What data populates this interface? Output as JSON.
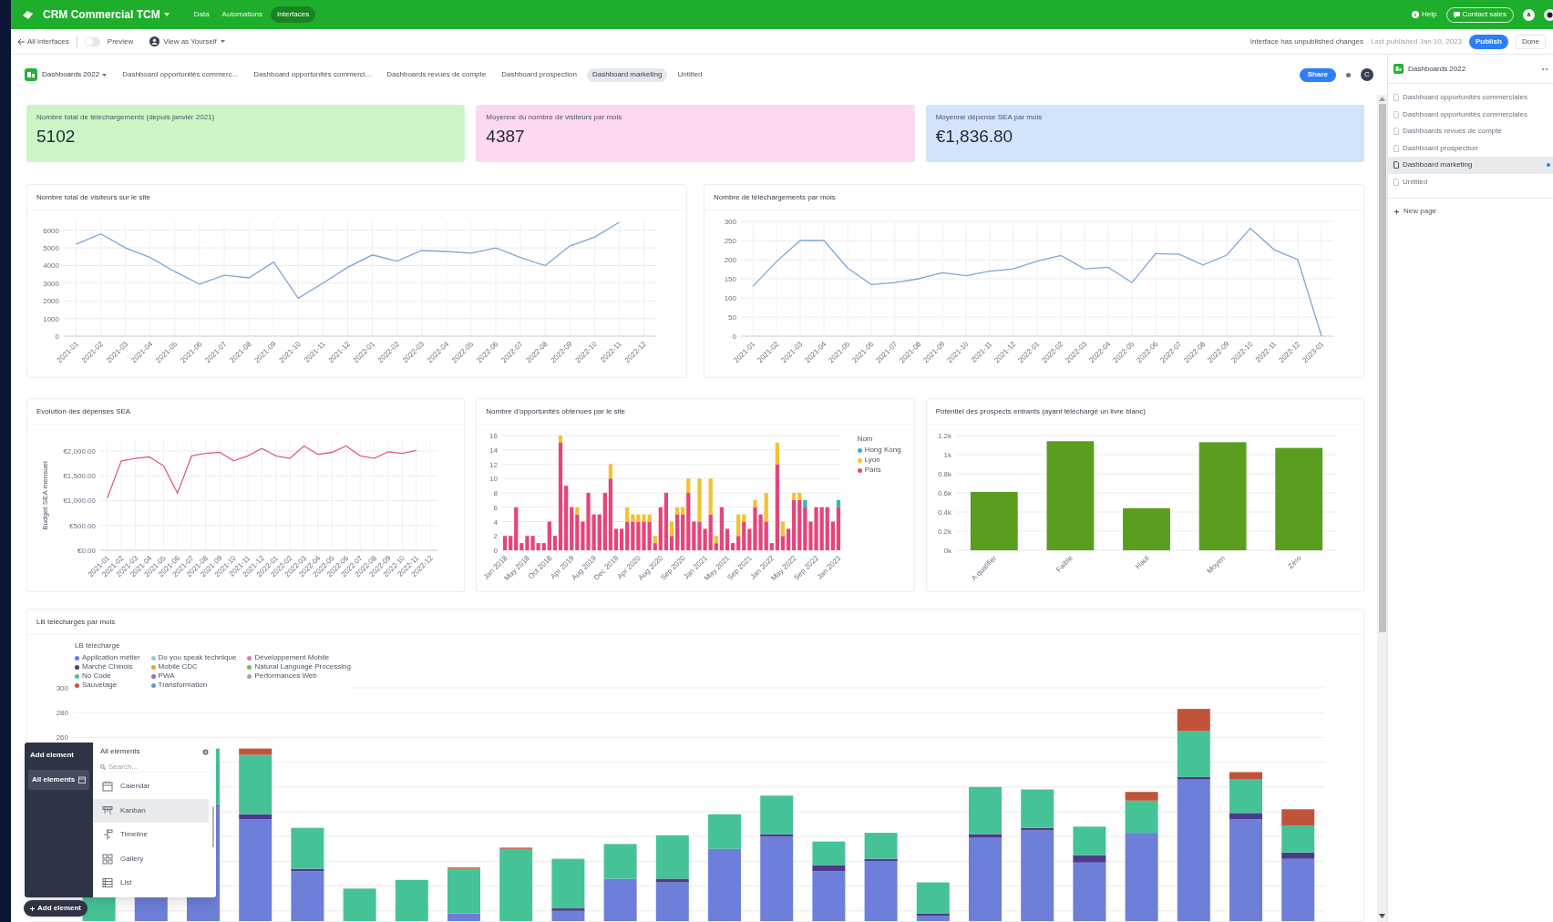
{
  "header": {
    "base_name": "CRM Commercial TCM",
    "nav": [
      {
        "label": "Data",
        "selected": false
      },
      {
        "label": "Automations",
        "selected": false
      },
      {
        "label": "Interfaces",
        "selected": true
      }
    ],
    "help": "Help",
    "contact": "Contact sales"
  },
  "toolbar": {
    "back": "All interfaces",
    "preview": {
      "label": "Preview",
      "on": false
    },
    "view_as": "View as Yourself",
    "status": "Interface has unpublished changes",
    "last_published": "Last published Jan 10, 2023",
    "publish": "Publish",
    "done": "Done"
  },
  "page_tabs": {
    "group": "Dashboards 2022",
    "tabs": [
      {
        "label": "Dashboard opportunités commerc...",
        "selected": false
      },
      {
        "label": "Dashboard opportunités commerci...",
        "selected": false
      },
      {
        "label": "Dashboards revues de compte",
        "selected": false
      },
      {
        "label": "Dashboard prospection",
        "selected": false
      },
      {
        "label": "Dashboard marketing",
        "selected": true
      },
      {
        "label": "Untitled",
        "selected": false
      }
    ],
    "share": "Share",
    "avatar": "C"
  },
  "kpis": [
    {
      "label": "Nombre total de téléchargements (depuis janvier 2021)",
      "value": "5102",
      "color": "#cdf6c6"
    },
    {
      "label": "Moyenne du nombre de visiteurs par mois",
      "value": "4387",
      "color": "#fcd9f1"
    },
    {
      "label": "Moyenne dépense SEA par mois",
      "value": "€1,836.80",
      "color": "#d3e3fb"
    }
  ],
  "charts": [
    {
      "title": "Nombre total de visiteurs sur le site",
      "chart_data": {
        "type": "line",
        "categories": [
          "2021-01",
          "2021-02",
          "2021-03",
          "2021-04",
          "2021-05",
          "2021-06",
          "2021-07",
          "2021-08",
          "2021-09",
          "2021-10",
          "2021-11",
          "2021-12",
          "2022-01",
          "2022-02",
          "2022-03",
          "2022-04",
          "2022-05",
          "2022-06",
          "2022-07",
          "2022-08",
          "2022-09",
          "2022-10",
          "2022-11",
          "2022-12"
        ],
        "series": [
          {
            "color": "#7ea6d6",
            "values": [
              5200,
              5800,
              5000,
              4450,
              3650,
              2950,
              3450,
              3300,
              4200,
              2150,
              3000,
              3900,
              4600,
              4250,
              4850,
              4800,
              4700,
              5000,
              4450,
              4000,
              5100,
              5600,
              6450,
              null
            ]
          }
        ],
        "ylim": [
          0,
          6500
        ],
        "yticks": [
          0,
          1000,
          2000,
          3000,
          4000,
          5000,
          6000
        ],
        "grid": true
      }
    },
    {
      "title": "Nombre de téléchargements par mois",
      "chart_data": {
        "type": "line",
        "categories": [
          "2021-01",
          "2021-02",
          "2021-03",
          "2021-04",
          "2021-05",
          "2021-06",
          "2021-07",
          "2021-08",
          "2021-09",
          "2021-10",
          "2021-11",
          "2021-12",
          "2022-01",
          "2022-02",
          "2022-03",
          "2022-04",
          "2022-05",
          "2022-06",
          "2022-07",
          "2022-08",
          "2022-09",
          "2022-10",
          "2022-11",
          "2022-12",
          "2023-01"
        ],
        "series": [
          {
            "color": "#7ea6d6",
            "values": [
              130,
              195,
              250,
              250,
              178,
              135,
              140,
              150,
              166,
              158,
              170,
              176,
              196,
              211,
              176,
              180,
              140,
              216,
              214,
              186,
              212,
              282,
              226,
              200,
              0
            ]
          }
        ],
        "ylim": [
          0,
          300
        ],
        "yticks": [
          0,
          50,
          100,
          150,
          200,
          250,
          300
        ],
        "grid": true
      }
    },
    {
      "title": "Evolution des dépenses SEA",
      "chart_data": {
        "type": "line",
        "ylabel": "Budget SEA mensuel",
        "categories": [
          "2021-01",
          "2021-02",
          "2021-03",
          "2021-04",
          "2021-05",
          "2021-06",
          "2021-07",
          "2021-08",
          "2021-09",
          "2021-10",
          "2021-11",
          "2021-12",
          "2022-01",
          "2022-02",
          "2022-03",
          "2022-04",
          "2022-05",
          "2022-06",
          "2022-07",
          "2022-08",
          "2022-09",
          "2022-10",
          "2022-11",
          "2022-12"
        ],
        "series": [
          {
            "color": "#e0607a",
            "values": [
              1050,
              1800,
              1850,
              1880,
              1700,
              1150,
              1900,
              1950,
              1970,
              1800,
              1900,
              2050,
              1900,
              1850,
              2100,
              1930,
              1970,
              2100,
              1900,
              1850,
              1980,
              1950,
              2010,
              null
            ]
          }
        ],
        "ylim": [
          0,
          2200
        ],
        "yticks": [
          {
            "value": 0,
            "label": "€0.00"
          },
          {
            "value": 500,
            "label": "€500.00"
          },
          {
            "value": 1000,
            "label": "€1,000.00"
          },
          {
            "value": 1500,
            "label": "€1,500.00"
          },
          {
            "value": 2000,
            "label": "€2,000.00"
          }
        ],
        "grid": true
      }
    },
    {
      "title": "Nombre d'opportunités obtenues par le site",
      "legend_title": "Nom",
      "chart_data": {
        "type": "bar",
        "stacked": true,
        "categories": [
          "Jan 2018",
          null,
          null,
          null,
          "May 2018",
          null,
          null,
          null,
          "Oct 2018",
          null,
          null,
          null,
          "Apr 2019",
          null,
          null,
          null,
          "Aug 2019",
          null,
          null,
          null,
          "Dec 2019",
          null,
          null,
          null,
          "Apr 2020",
          null,
          null,
          null,
          "Aug 2020",
          null,
          null,
          null,
          "Sep 2020",
          null,
          null,
          null,
          "Jan 2021",
          null,
          null,
          null,
          "May 2021",
          null,
          null,
          null,
          "Sep 2021",
          null,
          null,
          null,
          "Jan 2022",
          null,
          null,
          null,
          "May 2022",
          null,
          null,
          null,
          "Sep 2022",
          null,
          null,
          null,
          "Jan 2023"
        ],
        "series": [
          {
            "name": "Paris",
            "color": "#e5457a",
            "values": [
              2,
              2,
              6,
              1,
              2,
              2,
              1,
              1,
              4,
              2,
              15,
              9,
              6,
              5,
              4,
              8,
              5,
              5,
              8,
              10,
              3,
              3,
              4,
              4,
              4,
              4,
              4,
              1,
              6,
              8,
              2,
              5,
              5,
              8,
              4,
              4,
              3,
              5,
              1,
              6,
              3,
              1,
              2,
              4,
              3,
              6,
              5,
              4,
              1,
              12,
              2,
              3,
              7,
              7,
              6,
              4,
              6,
              6,
              6,
              4,
              6
            ]
          },
          {
            "name": "Lyon",
            "color": "#f2c232",
            "values": [
              0,
              0,
              0,
              0,
              0,
              0,
              0,
              0,
              0,
              0,
              1,
              0,
              0,
              1,
              0,
              0,
              0,
              0,
              0,
              2,
              0,
              0,
              2,
              1,
              1,
              1,
              1,
              1,
              0,
              0,
              2,
              1,
              1,
              2,
              0,
              6,
              0,
              5,
              1,
              0,
              0,
              0,
              3,
              1,
              0,
              1,
              0,
              4,
              0,
              3,
              2,
              0,
              1,
              1,
              0,
              0,
              0,
              0,
              0,
              0,
              0
            ]
          },
          {
            "name": "Hong Kong",
            "color": "#38b3c4",
            "values": [
              0,
              0,
              0,
              0,
              0,
              0,
              0,
              0,
              0,
              0,
              0,
              0,
              0,
              0,
              0,
              0,
              0,
              0,
              0,
              0,
              0,
              0,
              0,
              0,
              0,
              0,
              0,
              0,
              0,
              0,
              0,
              0,
              0,
              0,
              0,
              0,
              0,
              0,
              0,
              0,
              0,
              0,
              0,
              0,
              0,
              0,
              0,
              0,
              0,
              0,
              0,
              0,
              0,
              0,
              1,
              0,
              0,
              0,
              0,
              0,
              1
            ]
          }
        ],
        "ylim": [
          0,
          16
        ],
        "yticks": [
          0,
          2,
          4,
          6,
          8,
          10,
          12,
          14,
          16
        ],
        "grid": true
      }
    },
    {
      "title": "Potentiel des prospects entrants (ayant téléchargé un livre blanc)",
      "chart_data": {
        "type": "bar",
        "categories": [
          "A qualifier",
          "Faible",
          "Haut",
          "Moyen",
          "Zéro"
        ],
        "series": [
          {
            "color": "#5a9e1f",
            "values": [
              0.61,
              1.14,
              0.44,
              1.13,
              1.07
            ]
          }
        ],
        "ylim": [
          0,
          1.2
        ],
        "yticks": [
          {
            "value": 0,
            "label": "0k"
          },
          {
            "value": 0.2,
            "label": "0.2k"
          },
          {
            "value": 0.4,
            "label": "0.4k"
          },
          {
            "value": 0.6,
            "label": "0.6k"
          },
          {
            "value": 0.8,
            "label": "0.8k"
          },
          {
            "value": 1,
            "label": "1k"
          },
          {
            "value": 1.2,
            "label": "1.2k"
          }
        ],
        "grid": true
      }
    },
    {
      "title": "LB téléchargés par mois",
      "legend_title": "LB téléchargé",
      "axis_labels": [
        "300",
        "280",
        "260"
      ],
      "legend": [
        {
          "name": "Application métier",
          "color": "#6d7fd8"
        },
        {
          "name": "Marché Chinois",
          "color": "#4b3a8e"
        },
        {
          "name": "No Code",
          "color": "#46c396"
        },
        {
          "name": "Sauvetage",
          "color": "#c1533b"
        },
        {
          "name": "Do you speak technique",
          "color": "#8fd1c8"
        },
        {
          "name": "Mobile CDC",
          "color": "#e8a33d"
        },
        {
          "name": "PWA",
          "color": "#9b6fc7"
        },
        {
          "name": "Transformation",
          "color": "#5b9bd5"
        },
        {
          "name": "Développement Mobile",
          "color": "#e57aa8"
        },
        {
          "name": "Natural Language Processing",
          "color": "#7fb85a"
        },
        {
          "name": "Performances Web",
          "color": "#a0a7b4"
        }
      ]
    }
  ],
  "sidebar": {
    "title": "Dashboards 2022",
    "pages": [
      {
        "label": "Dashboard opportunités commerciales",
        "selected": false,
        "unpublished": false
      },
      {
        "label": "Dashboard opportunités commerciales",
        "selected": false,
        "unpublished": false
      },
      {
        "label": "Dashboards revues de compte",
        "selected": false,
        "unpublished": false
      },
      {
        "label": "Dashboard prospection",
        "selected": false,
        "unpublished": false
      },
      {
        "label": "Dashboard marketing",
        "selected": true,
        "unpublished": true
      },
      {
        "label": "Untitled",
        "selected": false,
        "unpublished": false
      }
    ],
    "new_page": "New page"
  },
  "add_element": {
    "title": "Add element",
    "categories": [
      {
        "label": "All elements",
        "selected": true
      }
    ],
    "list_title": "All elements",
    "search_placeholder": "Search...",
    "items": [
      {
        "label": "Calendar",
        "kind": "calendar",
        "highlighted": false
      },
      {
        "label": "Kanban",
        "kind": "kanban",
        "highlighted": true
      },
      {
        "label": "Timeline",
        "kind": "timeline",
        "highlighted": false
      },
      {
        "label": "Gallery",
        "kind": "gallery",
        "highlighted": false
      },
      {
        "label": "List",
        "kind": "list",
        "highlighted": false
      }
    ],
    "button": "Add element"
  }
}
